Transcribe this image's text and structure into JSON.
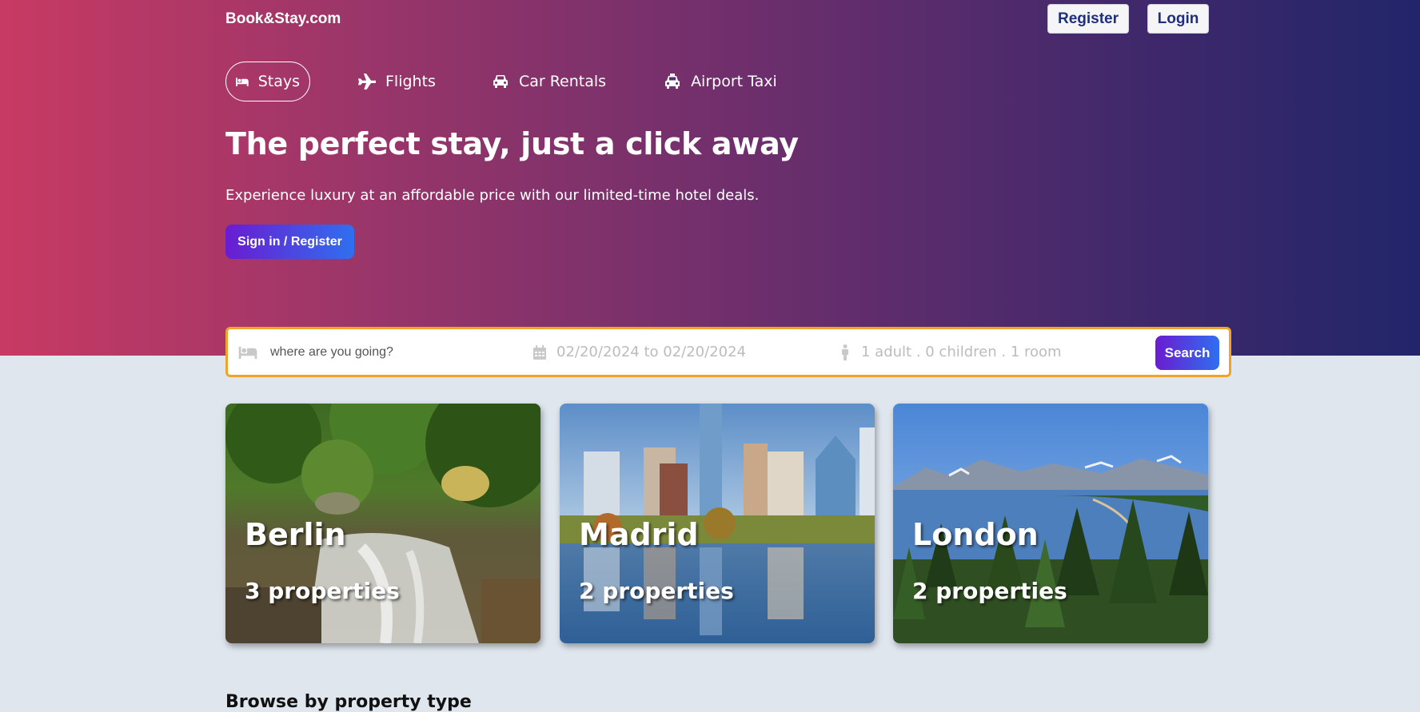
{
  "header": {
    "brand": "Book&Stay.com",
    "register_label": "Register",
    "login_label": "Login"
  },
  "nav": {
    "items": [
      {
        "label": "Stays",
        "icon": "bed-icon",
        "active": true
      },
      {
        "label": "Flights",
        "icon": "plane-icon",
        "active": false
      },
      {
        "label": "Car Rentals",
        "icon": "car-icon",
        "active": false
      },
      {
        "label": "Airport Taxi",
        "icon": "taxi-icon",
        "active": false
      }
    ]
  },
  "hero": {
    "headline": "The perfect stay, just a click away",
    "subtitle": "Experience luxury at an affordable price with our limited-time hotel deals.",
    "signin_label": "Sign in / Register"
  },
  "search": {
    "destination_placeholder": "where are you going?",
    "date_range": "02/20/2024 to 02/20/2024",
    "guests": "1 adult . 0 children . 1 room",
    "search_label": "Search"
  },
  "cities": [
    {
      "name": "Berlin",
      "properties": "3 properties"
    },
    {
      "name": "Madrid",
      "properties": "2 properties"
    },
    {
      "name": "London",
      "properties": "2 properties"
    }
  ],
  "sections": {
    "browse_title": "Browse by property type"
  },
  "colors": {
    "accent_gradient_start": "#6a1cd0",
    "accent_gradient_end": "#2f6ff0",
    "search_border": "#f0a327",
    "hero_start": "#c73a63",
    "hero_end": "#22256a"
  }
}
